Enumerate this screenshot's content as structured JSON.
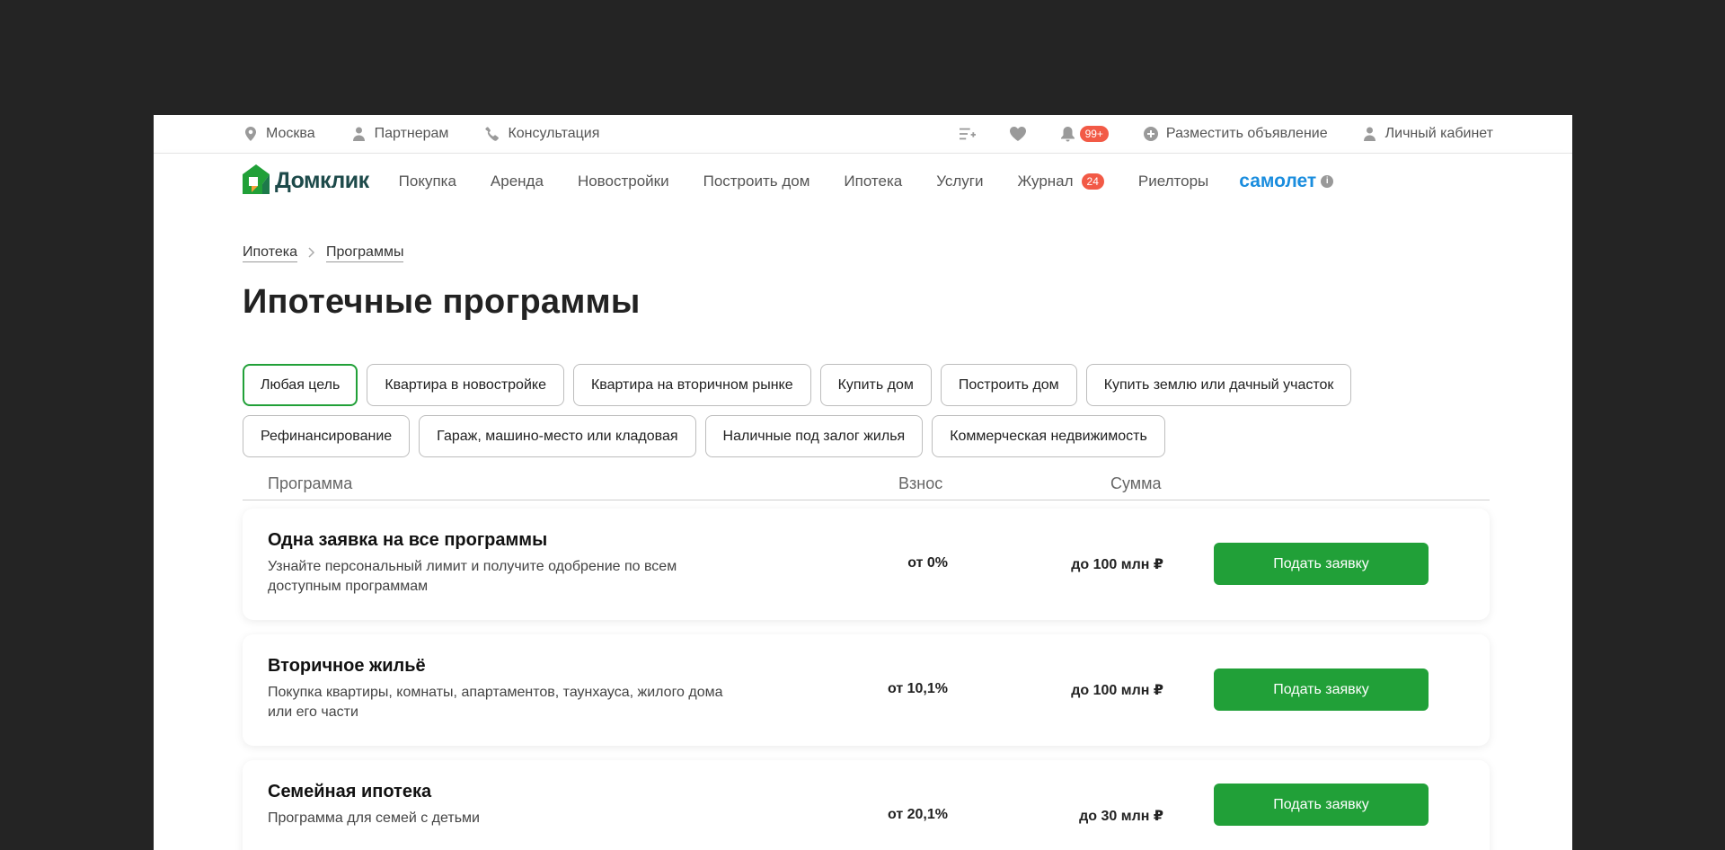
{
  "topbar": {
    "city": "Москва",
    "partners": "Партнерам",
    "consult": "Консультация",
    "notifications_badge": "99+",
    "post_ad": "Разместить объявление",
    "cabinet": "Личный кабинет"
  },
  "nav": {
    "logo": "Домклик",
    "items": [
      "Покупка",
      "Аренда",
      "Новостройки",
      "Построить дом",
      "Ипотека",
      "Услуги",
      "Журнал",
      "Риелторы"
    ],
    "journal_badge": "24",
    "partner_brand": "самолет"
  },
  "breadcrumb": [
    "Ипотека",
    "Программы"
  ],
  "title": "Ипотечные программы",
  "chips_row1": [
    "Любая цель",
    "Квартира в новостройке",
    "Квартира на вторичном рынке",
    "Купить дом",
    "Построить дом",
    "Купить землю или дачный участок"
  ],
  "chips_row2": [
    "Рефинансирование",
    "Гараж, машино-место или кладовая",
    "Наличные под залог жилья",
    "Коммерческая недвижимость"
  ],
  "table": {
    "col_program": "Программа",
    "col_fee": "Взнос",
    "col_sum": "Сумма",
    "rows": [
      {
        "title": "Одна заявка на все программы",
        "desc": "Узнайте персональный лимит и получите одобрение по всем доступным программам",
        "fee": "от 0%",
        "sum": "до 100 млн ₽",
        "button": "Подать заявку"
      },
      {
        "title": "Вторичное жильё",
        "desc": "Покупка квартиры, комнаты, апартаментов, таунхауса, жилого дома или его части",
        "fee": "от 10,1%",
        "sum": "до 100 млн ₽",
        "button": "Подать заявку"
      },
      {
        "title": "Семейная ипотека",
        "desc": "Программа для семей с детьми",
        "fee": "от 20,1%",
        "sum": "до 30 млн ₽",
        "button": "Подать заявку"
      }
    ]
  },
  "colors": {
    "accent": "#21a038",
    "badge": "#f25a46",
    "brand_blue": "#1a8dde"
  }
}
